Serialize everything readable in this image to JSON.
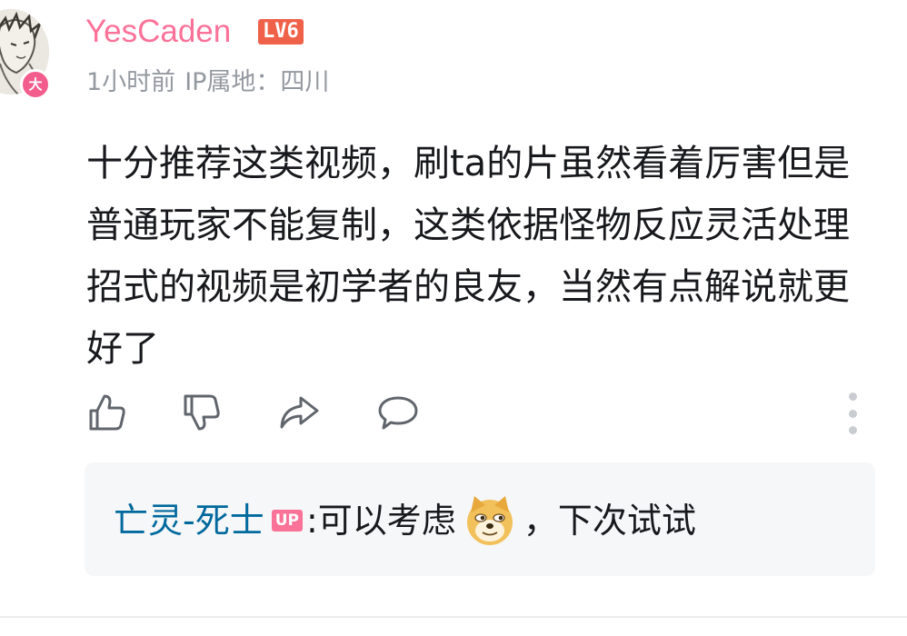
{
  "comment": {
    "author": {
      "name": "YesCaden",
      "level_badge": "LV6",
      "avatar_badge": "大",
      "name_color": "#fb7299",
      "avatar_icon": "avatar-sketch-icon"
    },
    "meta": {
      "time": "1小时前",
      "ip_location": "IP属地：四川"
    },
    "text": "十分推荐这类视频，刷ta的片虽然看着厉害但是普通玩家不能复制，这类依据怪物反应灵活处理招式的视频是初学者的良友，当然有点解说就更好了",
    "actions": {
      "like_icon": "thumbs-up-icon",
      "dislike_icon": "thumbs-down-icon",
      "share_icon": "share-arrow-icon",
      "reply_icon": "comment-bubble-icon",
      "more_icon": "more-vertical-icon"
    }
  },
  "reply": {
    "author": "亡灵-死士",
    "author_color": "#00699d",
    "up_badge": "UP",
    "separator": ":",
    "text_before": " 可以考虑",
    "emoji_icon": "doge-emoji-icon",
    "text_after": "，下次试试"
  }
}
